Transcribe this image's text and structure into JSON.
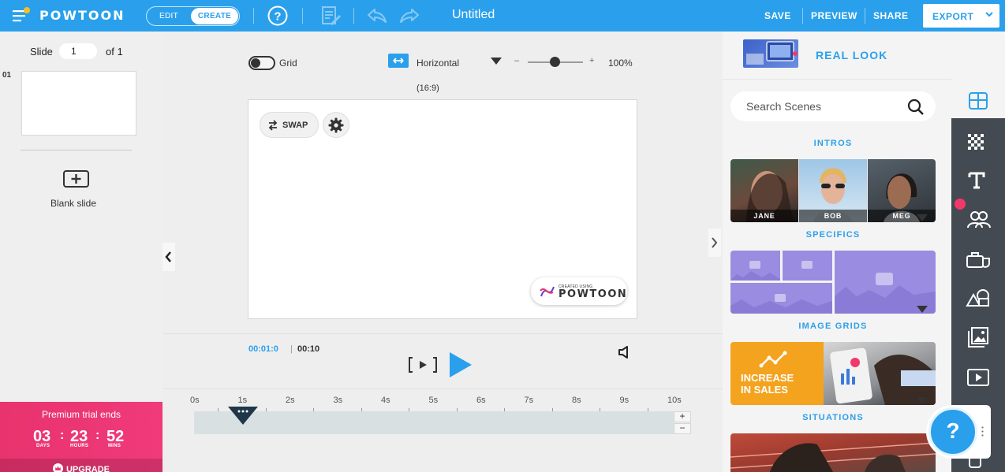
{
  "topbar": {
    "logo": "POWTOON",
    "mode_edit": "EDIT",
    "mode_create": "CREATE",
    "title": "Untitled",
    "save": "SAVE",
    "preview": "PREVIEW",
    "share": "SHARE",
    "export": "EXPORT"
  },
  "slides": {
    "label": "Slide",
    "current": "1",
    "of_label": "of 1",
    "thumb_index": "01",
    "blank_slide": "Blank slide"
  },
  "trial": {
    "title": "Premium trial ends",
    "days": "03",
    "days_cap": "DAYS",
    "hours": "23",
    "hours_cap": "HOURS",
    "mins": "52",
    "mins_cap": "MINS",
    "upgrade": "UPGRADE"
  },
  "canvas": {
    "grid_label": "Grid",
    "orientation": "Horizontal",
    "zoom": "100%",
    "ratio": "(16:9)",
    "swap": "SWAP",
    "badge_small": "CREATED USING",
    "badge_big": "POWTOON"
  },
  "timeline": {
    "current": "00:01:0",
    "separator": "|",
    "total": "00:10",
    "ticks": [
      "0s",
      "1s",
      "2s",
      "3s",
      "4s",
      "5s",
      "6s",
      "7s",
      "8s",
      "9s",
      "10s"
    ],
    "plus": "+",
    "minus": "−"
  },
  "library": {
    "style_name": "REAL LOOK",
    "search_placeholder": "Search Scenes",
    "categories": [
      "INTROS",
      "SPECIFICS",
      "IMAGE GRIDS",
      "SITUATIONS"
    ],
    "intro_people": [
      "JANE",
      "BOB",
      "MEG"
    ],
    "promo_text_1": "INCREASE",
    "promo_text_2": "IN SALES"
  },
  "help_fab": "?",
  "colors": {
    "brand_blue": "#2aa0ec",
    "trial_pink": "#e8336f",
    "toolbar_dark": "#444a52",
    "placeholder_purple": "#9a8ce0",
    "promo_orange": "#f4a31f"
  }
}
